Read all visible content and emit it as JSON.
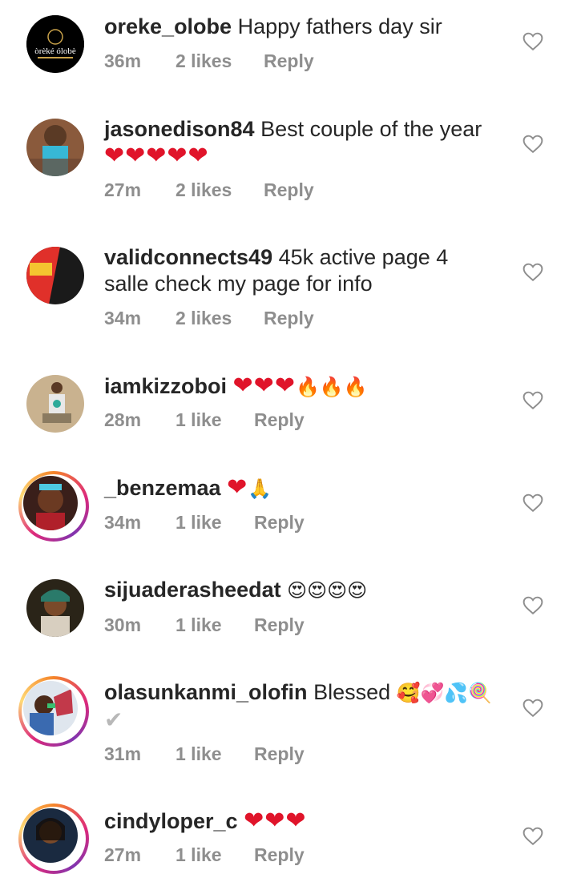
{
  "comments": [
    {
      "user": "oreke_olobe",
      "text": "Happy fathers day sir",
      "time": "36m",
      "likes": "2 likes",
      "reply": "Reply",
      "avatar_logo": "òrèké ólobè"
    },
    {
      "user": "jasonedison84",
      "text": "Best couple of the year",
      "emoji": "❤❤❤❤❤",
      "time": "27m",
      "likes": "2 likes",
      "reply": "Reply"
    },
    {
      "user": "validconnects49",
      "text": "45k active page 4",
      "text2": "salle check my page for info",
      "time": "34m",
      "likes": "2 likes",
      "reply": "Reply"
    },
    {
      "user": "iamkizzoboi",
      "emoji": "❤❤❤",
      "fire": "🔥🔥🔥",
      "time": "28m",
      "likes": "1 like",
      "reply": "Reply"
    },
    {
      "user": "_benzemaa",
      "emoji": "❤",
      "pray": "🙏",
      "time": "34m",
      "likes": "1 like",
      "reply": "Reply"
    },
    {
      "user": "sijuaderasheedat",
      "emoji": "😍😍😍😍",
      "time": "30m",
      "likes": "1 like",
      "reply": "Reply"
    },
    {
      "user": "olasunkanmi_olofin",
      "text": "Blessed",
      "emoji": "🥰💞💦🍭",
      "emoji2": "✔",
      "time": "31m",
      "likes": "1 like",
      "reply": "Reply"
    },
    {
      "user": "cindyloper_c",
      "emoji": "❤❤❤",
      "time": "27m",
      "likes": "1 like",
      "reply": "Reply"
    }
  ],
  "colors": {
    "heart": "#e0142a",
    "meta": "#8e8e8e",
    "text": "#262626"
  }
}
